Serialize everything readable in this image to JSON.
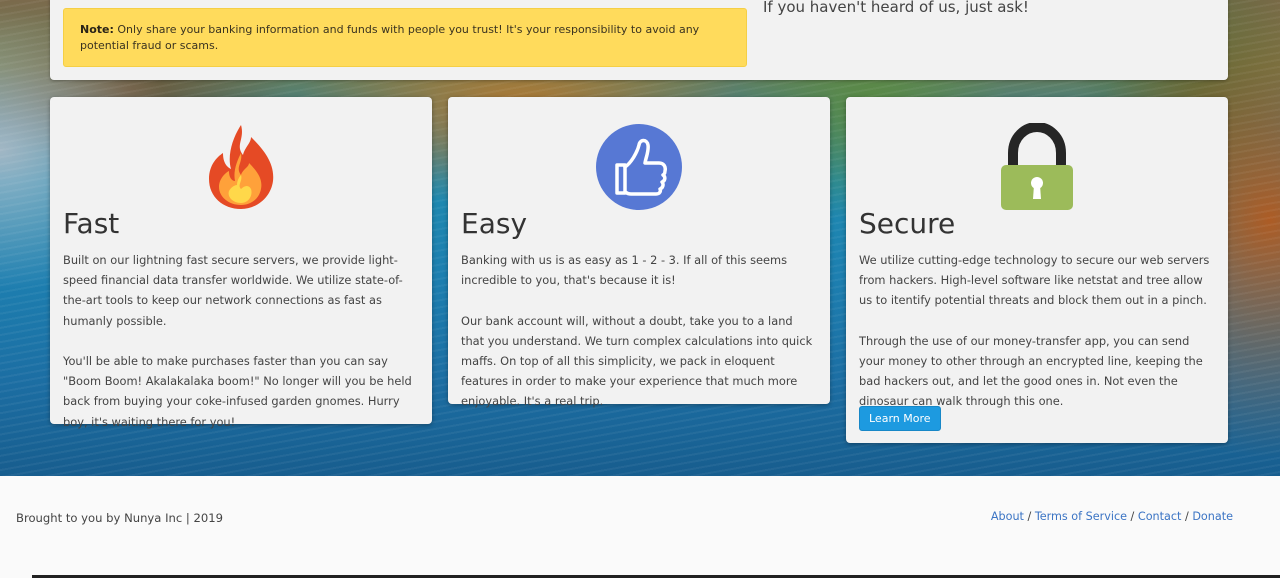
{
  "notice": {
    "label": "Note:",
    "text": "Only share your banking information and funds with people you trust! It's your responsibility to avoid any potential fraud or scams."
  },
  "top_right_text": "If you haven't heard of us, just ask!",
  "features": [
    {
      "title": "Fast",
      "icon": "flame-icon",
      "paragraphs": [
        "Built on our lightning fast secure servers, we provide light-speed financial data transfer worldwide. We utilize state-of-the-art tools to keep our network connections as fast as humanly possible.",
        "You'll be able to make purchases faster than you can say \"Boom Boom! Akalakalaka boom!\" No longer will you be held back from buying your coke-infused garden gnomes. Hurry boy, it's waiting there for you!"
      ]
    },
    {
      "title": "Easy",
      "icon": "thumbs-up-icon",
      "paragraphs": [
        "Banking with us is as easy as 1 - 2 - 3. If all of this seems incredible to you, that's because it is!",
        "Our bank account will, without a doubt, take you to a land that you understand. We turn complex calculations into quick maffs. On top of all this simplicity, we pack in eloquent features in order to make your experience that much more enjoyable. It's a real trip."
      ]
    },
    {
      "title": "Secure",
      "icon": "padlock-icon",
      "paragraphs": [
        "We utilize cutting-edge technology to secure our web servers from hackers. High-level software like netstat and tree allow us to itentify potential threats and block them out in a pinch.",
        "Through the use of our money-transfer app, you can send your money to other through an encrypted line, keeping the bad hackers out, and let the good ones in. Not even the dinosaur can walk through this one."
      ],
      "button_label": "Learn More"
    }
  ],
  "footer": {
    "credit": "Brought to you by Nunya Inc | 2019",
    "links": [
      "About",
      "Terms of Service",
      "Contact",
      "Donate"
    ],
    "separator": " / ",
    "link_color": "#3b74c4"
  },
  "colors": {
    "note_bg": "#ffdb5c",
    "button_bg": "#1d9ae0",
    "thumbs_circle": "#5778d4",
    "lock_body": "#9cbb5a",
    "flame_outer": "#e54a25",
    "flame_inner": "#ffd84a"
  }
}
